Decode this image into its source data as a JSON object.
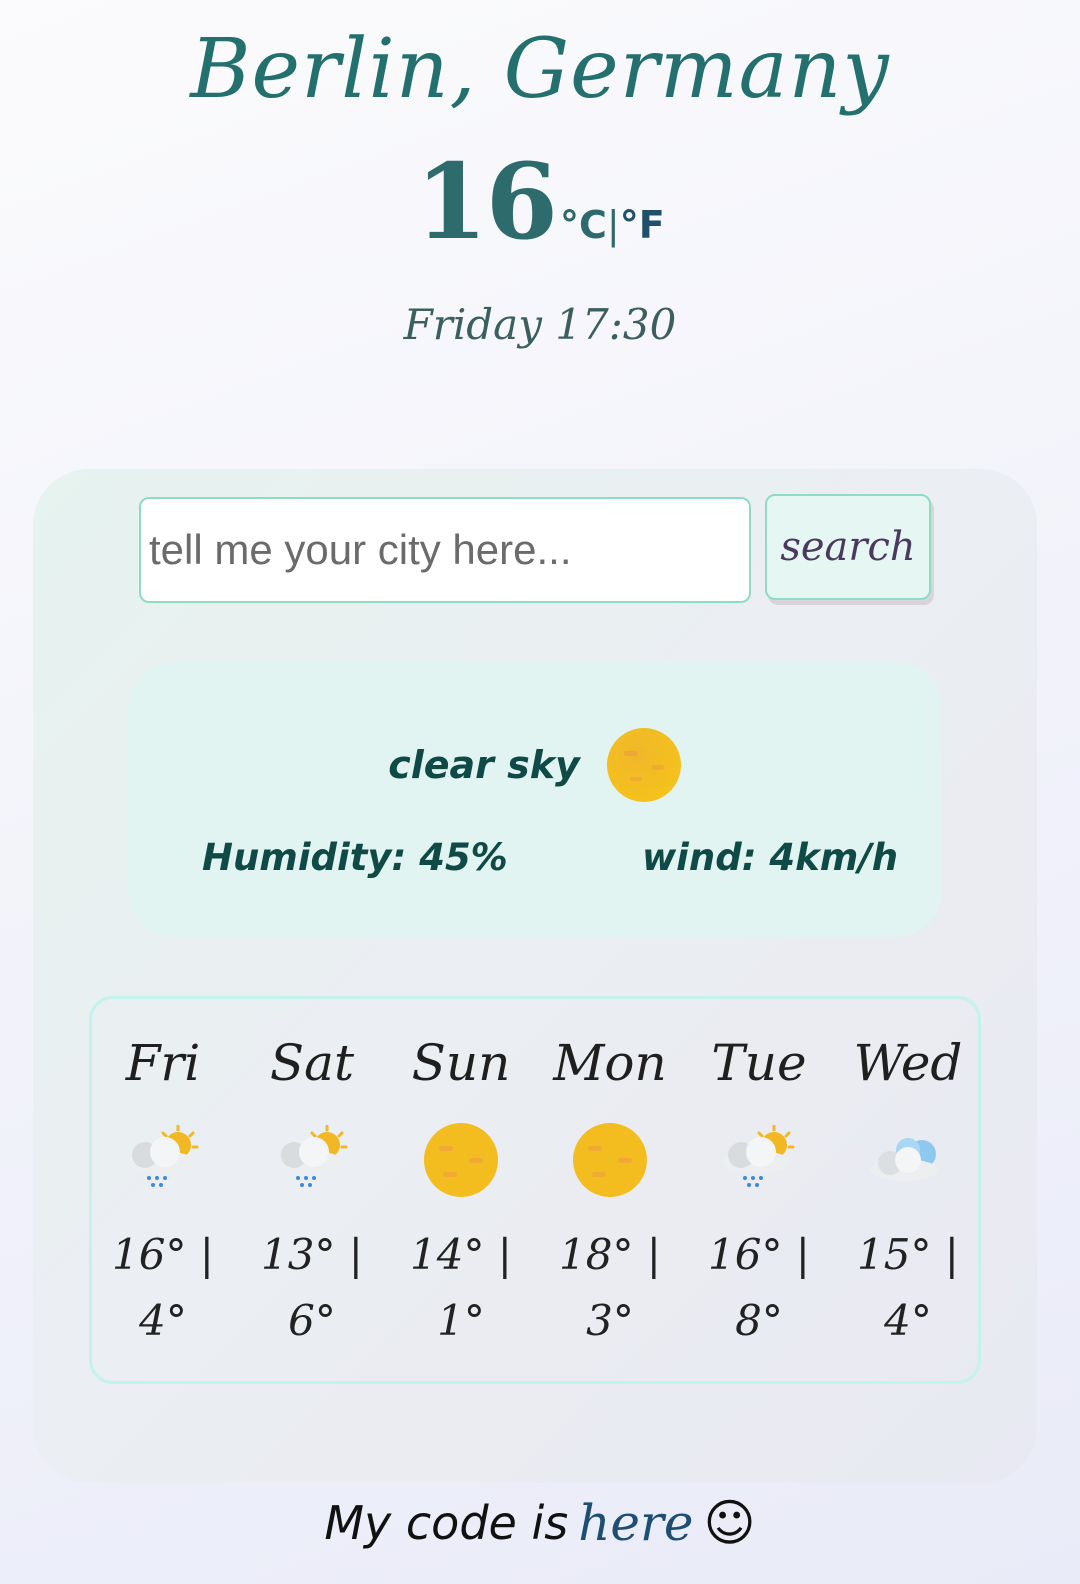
{
  "header": {
    "city": "Berlin, Germany",
    "temperature": "16",
    "unit_c": "°C",
    "unit_separator": "|",
    "unit_f": "°F",
    "datetime": "Friday 17:30"
  },
  "search": {
    "placeholder": "tell me your city here...",
    "button_label": "search"
  },
  "current": {
    "description": "clear sky",
    "icon": "sun-icon",
    "humidity": "Humidity: 45%",
    "wind": "wind: 4km/h"
  },
  "forecast": [
    {
      "day": "Fri",
      "icon": "sun-cloud-rain-icon",
      "high": "16° |",
      "low": "4°"
    },
    {
      "day": "Sat",
      "icon": "sun-cloud-rain-icon",
      "high": "13° |",
      "low": "6°"
    },
    {
      "day": "Sun",
      "icon": "sun-icon",
      "high": "14° |",
      "low": "1°"
    },
    {
      "day": "Mon",
      "icon": "sun-icon",
      "high": "18° |",
      "low": "3°"
    },
    {
      "day": "Tue",
      "icon": "sun-cloud-rain-icon",
      "high": "16° |",
      "low": "8°"
    },
    {
      "day": "Wed",
      "icon": "cloud-icon",
      "high": "15° |",
      "low": "4°"
    }
  ],
  "footer": {
    "text": "My code is",
    "link_text": "here",
    "emoji": "☺"
  },
  "colors": {
    "accent": "#23706f",
    "border": "#8fdcc4",
    "sun": "#f5b315"
  }
}
